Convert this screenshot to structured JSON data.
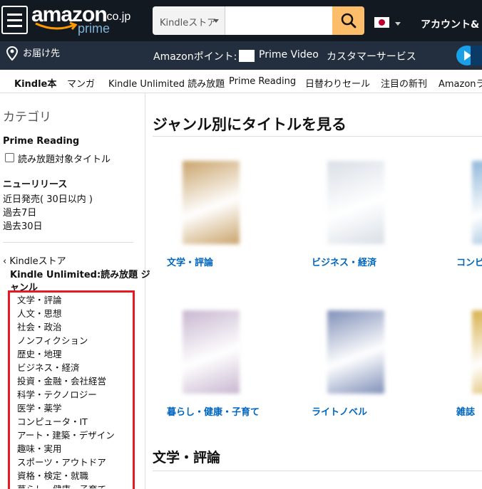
{
  "header": {
    "logo_word": "amazon",
    "logo_tld": ".co.jp",
    "logo_sub": "prime",
    "search_category": "Kindleストア",
    "search_placeholder": "",
    "account_label": "アカウント&",
    "colors": {
      "header_bg": "#131921",
      "subnav_bg": "#232f3e",
      "search_button": "#febd69"
    }
  },
  "subnav": {
    "deliver_label": "お届け先",
    "points_label": "Amazonポイント:",
    "prime_video": "Prime Video",
    "customer_service": "カスタマーサービス"
  },
  "catnav": [
    "Kindle本",
    "マンガ",
    "Kindle Unlimited 読み放題",
    "Prime Reading",
    "日替わりセール",
    "注目の新刊",
    "Amazonラ"
  ],
  "sidebar": {
    "title": "カテゴリ",
    "prime_reading_head": "Prime Reading",
    "prime_reading_option": "読み放題対象タイトル",
    "new_release_head": "ニューリリース",
    "new_release_items": [
      "近日発売( 30日以内 )",
      "過去7日",
      "過去30日"
    ],
    "store_back": "Kindleストア",
    "unlimited_head_line1": "Kindle Unlimited:読み放題 ジ",
    "unlimited_head_line2": "ャンル",
    "genres": [
      "文学・評論",
      "人文・思想",
      "社会・政治",
      "ノンフィクション",
      "歴史・地理",
      "ビジネス・経済",
      "投資・金融・会社経営",
      "科学・テクノロジー",
      "医学・薬学",
      "コンピュータ・IT",
      "アート・建築・デザイン",
      "趣味・実用",
      "スポーツ・アウトドア",
      "資格・検定・就職",
      "暮らし・健康・子育て"
    ]
  },
  "main": {
    "title": "ジャンル別にタイトルを見る",
    "tiles": [
      {
        "label": "文学・評論",
        "cover_color": "#c9a36a"
      },
      {
        "label": "ビジネス・経済",
        "cover_color": "#d9dfe6"
      },
      {
        "label": "コンピ",
        "cover_color": "#8fb7d9"
      },
      {
        "label": "暮らし・健康・子育て",
        "cover_color": "#c7b6cf"
      },
      {
        "label": "ライトノベル",
        "cover_color": "#7f8fb8"
      },
      {
        "label": "雑誌",
        "cover_color": "#d7b04a"
      }
    ],
    "section2_title": "文学・評論"
  }
}
